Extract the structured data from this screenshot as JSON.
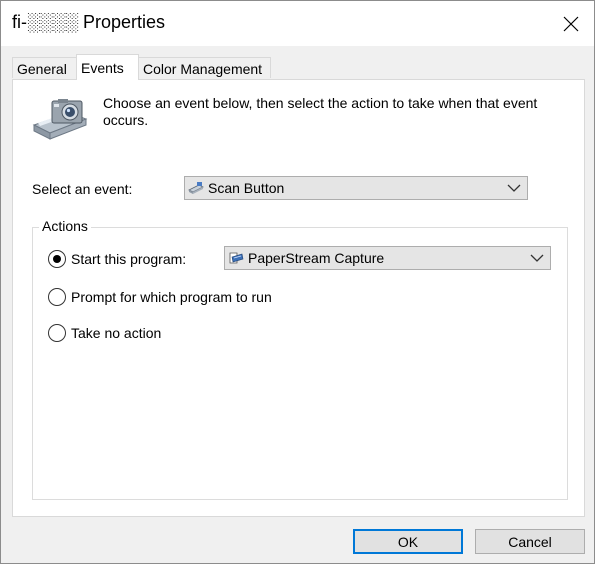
{
  "window": {
    "title": "fi-░░░░ Properties"
  },
  "tabs": [
    {
      "label": "General",
      "active": false
    },
    {
      "label": "Events",
      "active": true
    },
    {
      "label": "Color Management",
      "active": false
    }
  ],
  "events_tab": {
    "intro": "Choose an event below, then select the action to take when that event occurs.",
    "select_event_label": "Select an event:",
    "selected_event": "Scan Button",
    "actions_legend": "Actions",
    "actions": [
      {
        "label": "Start this program:",
        "checked": true
      },
      {
        "label": "Prompt for which program to run",
        "checked": false
      },
      {
        "label": "Take no action",
        "checked": false
      }
    ],
    "selected_program": "PaperStream Capture"
  },
  "buttons": {
    "ok": "OK",
    "cancel": "Cancel"
  },
  "colors": {
    "focus_border": "#0078d7",
    "panel_bg": "#ffffff",
    "window_bg": "#f0f0f0"
  }
}
